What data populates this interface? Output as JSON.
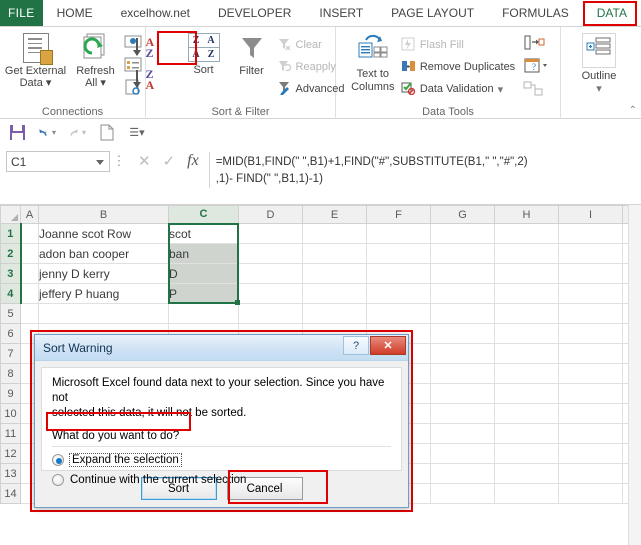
{
  "ribbon": {
    "file_label": "FILE",
    "tabs": [
      {
        "label": "HOME",
        "active": false
      },
      {
        "label": "excelhow.net",
        "active": false
      },
      {
        "label": "DEVELOPER",
        "active": false
      },
      {
        "label": "INSERT",
        "active": false
      },
      {
        "label": "PAGE LAYOUT",
        "active": false
      },
      {
        "label": "FORMULAS",
        "active": false
      },
      {
        "label": "DATA",
        "active": true
      }
    ],
    "groups": {
      "connections": {
        "label": "Connections",
        "get_external_data": "Get External\nData",
        "get_external_data_l1": "Get External",
        "get_external_data_l2": "Data",
        "refresh_all_l1": "Refresh",
        "refresh_all_l2": "All"
      },
      "sort_filter": {
        "label": "Sort & Filter",
        "sort_az": "A\nZ",
        "sort_za": "Z\nA",
        "sort_button": "Sort",
        "filter_button": "Filter",
        "clear": "Clear",
        "reapply": "Reapply",
        "advanced": "Advanced"
      },
      "data_tools": {
        "label": "Data Tools",
        "text_to_columns_l1": "Text to",
        "text_to_columns_l2": "Columns",
        "flash_fill": "Flash Fill",
        "remove_duplicates": "Remove Duplicates",
        "data_validation": "Data Validation"
      },
      "outline": {
        "label": "Outline",
        "button": "Outline"
      }
    }
  },
  "formula_bar": {
    "name_box_value": "C1",
    "formula": "=MID(B1,FIND(\" \",B1)+1,FIND(\"#\",SUBSTITUTE(B1,\" \",\"#\",2)\n,1)- FIND(\" \",B1,1)-1)",
    "cancel_icon": "✕",
    "enter_icon": "✓",
    "fx_icon": "fx"
  },
  "sheet": {
    "columns": [
      "A",
      "B",
      "C",
      "D",
      "E",
      "F",
      "G",
      "H",
      "I"
    ],
    "selected_column": "C",
    "rows": [
      1,
      2,
      3,
      4,
      5,
      6,
      7,
      8,
      9,
      10,
      11,
      12,
      13,
      14
    ],
    "selected_rows": [
      1,
      2,
      3,
      4
    ],
    "data": [
      {
        "row": 1,
        "B": "Joanne scot Row",
        "C": "scot"
      },
      {
        "row": 2,
        "B": "adon ban cooper",
        "C": "ban"
      },
      {
        "row": 3,
        "B": "jenny D kerry",
        "C": "D"
      },
      {
        "row": 4,
        "B": "jeffery P huang",
        "C": "P"
      }
    ]
  },
  "dialog": {
    "title": "Sort Warning",
    "help_button": "?",
    "close_button": "✕",
    "message_line1": "Microsoft Excel found data next to your selection.  Since you have not",
    "message_line2": "selected this data, it will not be sorted.",
    "question": "What do you want to do?",
    "options": [
      {
        "label": "Expand the selection",
        "selected": true
      },
      {
        "label": "Continue with the current selection",
        "selected": false
      }
    ],
    "buttons": [
      {
        "label": "Sort",
        "default": true
      },
      {
        "label": "Cancel",
        "default": false
      }
    ]
  },
  "colors": {
    "excel_green": "#217346",
    "highlight_red": "#e00000",
    "selection_fill": "#cfd4cf",
    "dialog_titlebar": "#c3dcf2",
    "radio_blue": "#1579c8"
  }
}
